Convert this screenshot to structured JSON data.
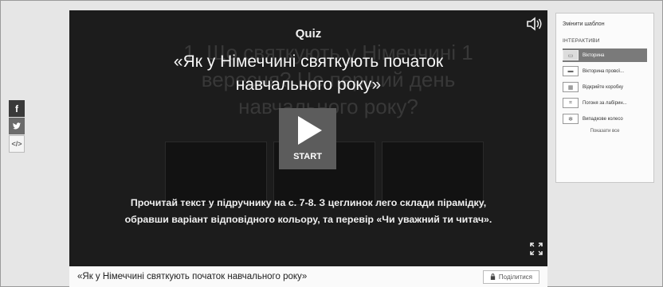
{
  "share": {
    "facebook": "f",
    "twitter": "t",
    "embed": "</>"
  },
  "player": {
    "ghost_title": "1. Що святкують у Німеччині 1 вересня? Це перший день навчального року?",
    "quiz_label": "Quiz",
    "title": "«Як у Німеччині святкують початок навчального року»",
    "start_label": "START",
    "description": "Прочитай текст у підручнику на с. 7-8. З цеглинок лего склади пірамідку, обравши варіант відповідного кольору, та перевір «Чи уважний ти читач».",
    "sound_icon": "speaker-icon",
    "fullscreen_icon": "fullscreen-icon"
  },
  "footer": {
    "title": "«Як у Німеччині святкують початок навчального року»",
    "share_label": "Поділитися"
  },
  "panel": {
    "change_template": "Змінити шаблон",
    "section": "ІНТЕРАКТИВИ",
    "items": [
      {
        "label": "Вікторина",
        "active": true
      },
      {
        "label": "Вікторина прової...",
        "active": false
      },
      {
        "label": "Відкрийте коробку",
        "active": false
      },
      {
        "label": "Погоня за лабірин...",
        "active": false
      },
      {
        "label": "Випадкове колесо",
        "active": false
      }
    ],
    "show_all": "Показати все"
  }
}
